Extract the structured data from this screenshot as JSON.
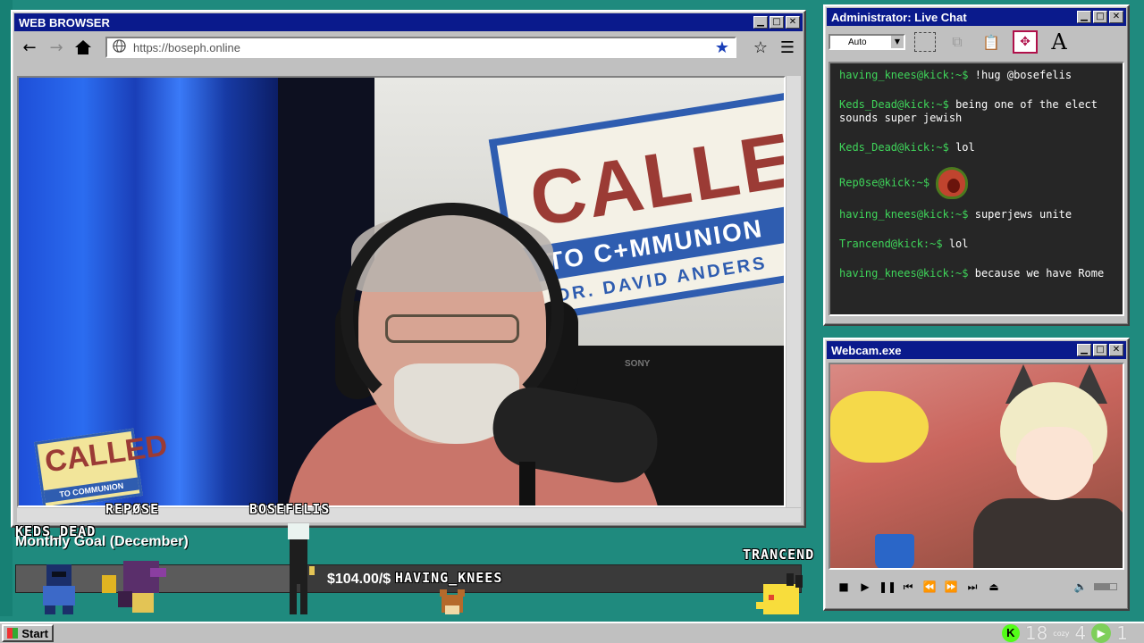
{
  "browser": {
    "title": "WEB BROWSER",
    "url": "https://boseph.online",
    "controls": {
      "minimize": "▁",
      "maximize": "□",
      "close": "✕"
    },
    "scene": {
      "sign_title": "CALLED",
      "sign_band": "TO C+MMUNION",
      "sign_sub": "DR. DAVID ANDERS",
      "small_logo_title": "CALLED",
      "small_logo_band": "TO COMMUNION",
      "camera_brand": "SONY"
    }
  },
  "viewers": [
    "REPØSE",
    "BOSEFELIS",
    "KEDS_DEAD",
    "TRANCEND",
    "HAVING_KNEES"
  ],
  "chat": {
    "title": "Administrator: Live Chat",
    "zoom_select": "Auto",
    "messages": [
      {
        "user": "having_knees@kick:~$",
        "text": "!hug @bosefelis"
      },
      {
        "user": "Keds_Dead@kick:~$",
        "text": "being one of the elect sounds super jewish"
      },
      {
        "user": "Keds_Dead@kick:~$",
        "text": "lol"
      },
      {
        "user": "Rep0se@kick:~$",
        "text": ""
      },
      {
        "user": "having_knees@kick:~$",
        "text": "superjews unite"
      },
      {
        "user": "Trancend@kick:~$",
        "text": "lol"
      },
      {
        "user": "having_knees@kick:~$",
        "text": "because we have Rome"
      }
    ]
  },
  "webcam": {
    "title": "Webcam.exe"
  },
  "goal": {
    "label": "Monthly Goal (December)",
    "amount": "$104.00/$",
    "progress": 0.35
  },
  "taskbar": {
    "start": "Start",
    "tray_kick": "K",
    "count_a": "18",
    "cozy": "cozy",
    "count_b": "4",
    "count_c": "1"
  }
}
